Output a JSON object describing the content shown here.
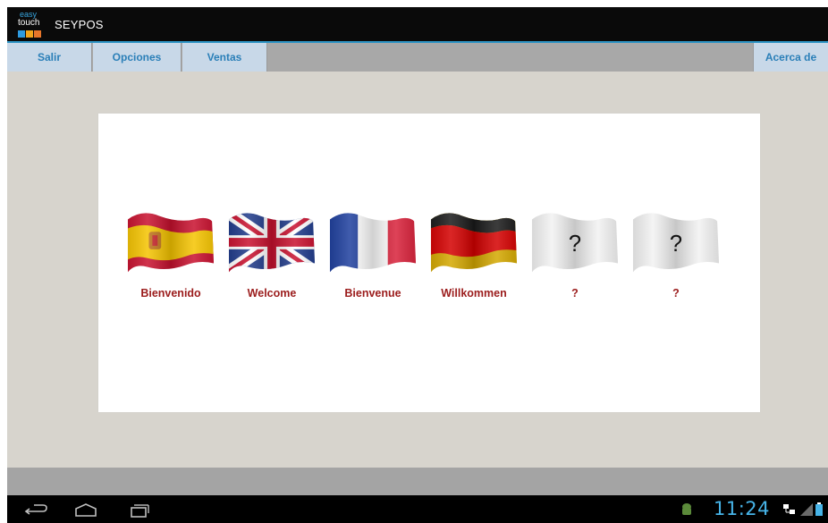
{
  "app": {
    "logo_line1": "easy",
    "logo_line2": "touch",
    "title": "SEYPOS"
  },
  "menu": {
    "salir": "Salir",
    "opciones": "Opciones",
    "ventas": "Ventas",
    "acerca": "Acerca de"
  },
  "languages": [
    {
      "label": "Bienvenido",
      "icon": "spain-flag-icon"
    },
    {
      "label": "Welcome",
      "icon": "uk-flag-icon"
    },
    {
      "label": "Bienvenue",
      "icon": "france-flag-icon"
    },
    {
      "label": "Willkommen",
      "icon": "germany-flag-icon"
    },
    {
      "label": "?",
      "icon": "blank-flag-icon",
      "flag_text": "?"
    },
    {
      "label": "?",
      "icon": "blank-flag-icon",
      "flag_text": "?"
    }
  ],
  "statusbar": {
    "time": "11:24"
  },
  "colors": {
    "accent": "#2b93c4",
    "menu_text": "#2a7fb8",
    "label_text": "#9b1c1c",
    "clock": "#47b4e8"
  }
}
